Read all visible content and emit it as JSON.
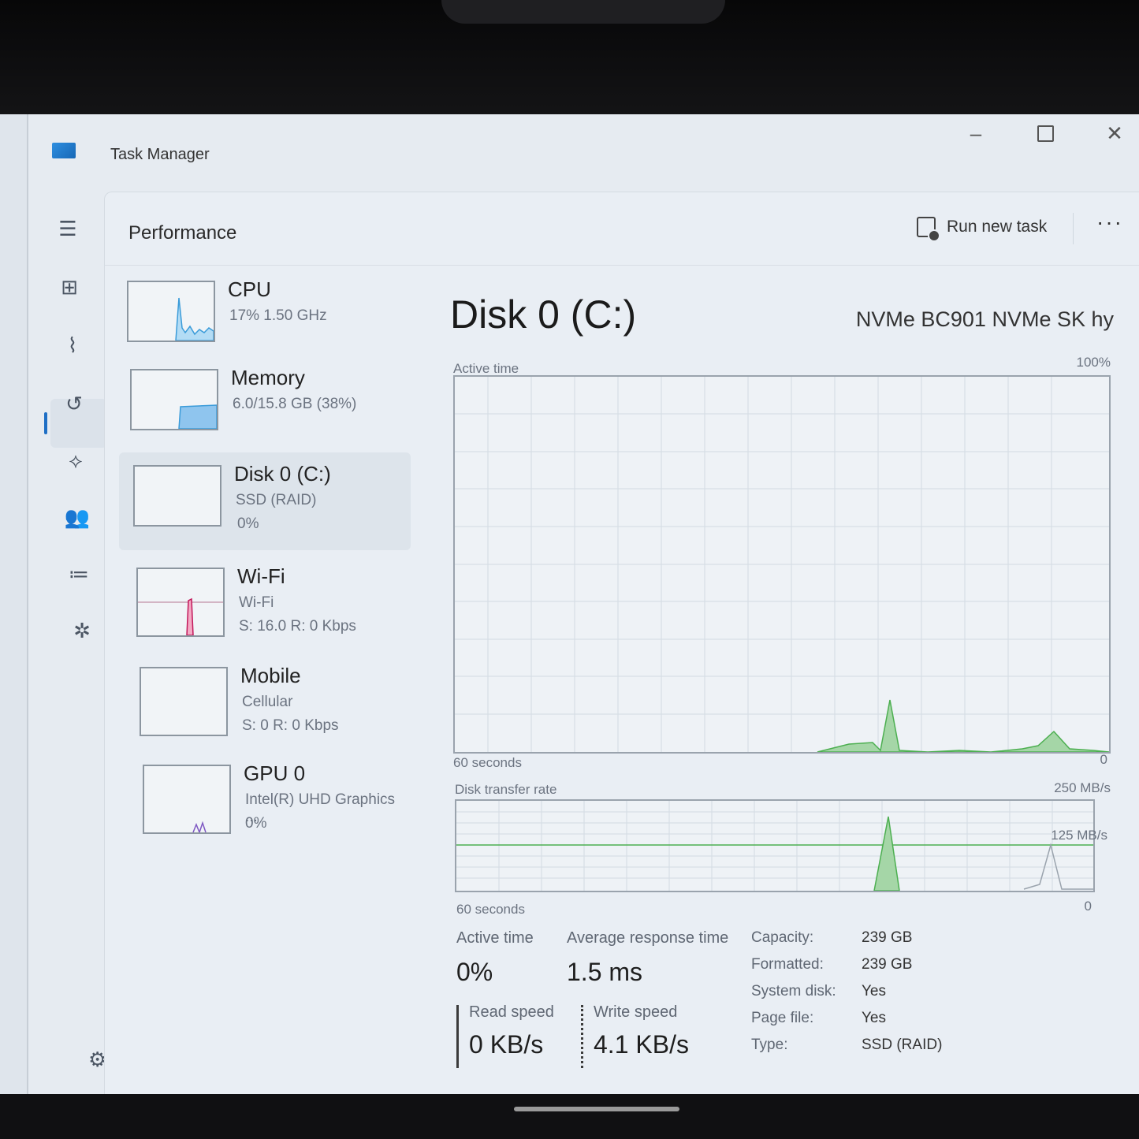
{
  "window": {
    "title": "Task Manager",
    "controls": {
      "minimize": "–",
      "close": "✕"
    }
  },
  "nav": {
    "items": [
      {
        "name": "menu",
        "glyph": "☰"
      },
      {
        "name": "processes",
        "glyph": "⊞"
      },
      {
        "name": "performance",
        "glyph": "⌇",
        "active": true
      },
      {
        "name": "app-history",
        "glyph": "↺"
      },
      {
        "name": "startup-apps",
        "glyph": "⟡"
      },
      {
        "name": "users",
        "glyph": "👥"
      },
      {
        "name": "details",
        "glyph": "≔"
      },
      {
        "name": "services",
        "glyph": "✲"
      }
    ],
    "settings_glyph": "⚙"
  },
  "header": {
    "title": "Performance",
    "run_new_task": "Run new task",
    "more": "···"
  },
  "devices": [
    {
      "name": "CPU",
      "sub1": "17%  1.50 GHz",
      "sub2": "",
      "selected": false,
      "color": "#3a9bd9"
    },
    {
      "name": "Memory",
      "sub1": "6.0/15.8 GB (38%)",
      "sub2": "",
      "selected": false,
      "color": "#3a9bd9"
    },
    {
      "name": "Disk 0 (C:)",
      "sub1": "SSD (RAID)",
      "sub2": "0%",
      "selected": true,
      "color": "#4caf50"
    },
    {
      "name": "Wi-Fi",
      "sub1": "Wi-Fi",
      "sub2": "S: 16.0  R: 0 Kbps",
      "selected": false,
      "color": "#c2185b"
    },
    {
      "name": "Mobile",
      "sub1": "Cellular",
      "sub2": "S: 0  R: 0 Kbps",
      "selected": false,
      "color": "#c2185b"
    },
    {
      "name": "GPU 0",
      "sub1": "Intel(R) UHD Graphics ...",
      "sub2": "0%",
      "selected": false,
      "color": "#7e57c2"
    }
  ],
  "detail": {
    "title": "Disk 0 (C:)",
    "model": "NVMe BC901 NVMe SK hy",
    "active_time_graph": {
      "label": "Active time",
      "max_label": "100%",
      "x_left": "60 seconds",
      "x_right": "0"
    },
    "transfer_graph": {
      "label": "Disk transfer rate",
      "max_label": "250 MB/s",
      "mid_label": "125 MB/s",
      "x_left": "60 seconds",
      "x_right": "0"
    },
    "stats": {
      "active_time_label": "Active time",
      "active_time_value": "0%",
      "avg_response_label": "Average response time",
      "avg_response_value": "1.5 ms",
      "read_speed_label": "Read speed",
      "read_speed_value": "0 KB/s",
      "write_speed_label": "Write speed",
      "write_speed_value": "4.1 KB/s"
    },
    "properties": [
      {
        "label": "Capacity:",
        "value": "239 GB"
      },
      {
        "label": "Formatted:",
        "value": "239 GB"
      },
      {
        "label": "System disk:",
        "value": "Yes"
      },
      {
        "label": "Page file:",
        "value": "Yes"
      },
      {
        "label": "Type:",
        "value": "SSD (RAID)"
      }
    ]
  },
  "colors": {
    "disk_green": "#4caf50",
    "disk_fill": "#a5d6a7",
    "accent": "#1f6fc5"
  }
}
